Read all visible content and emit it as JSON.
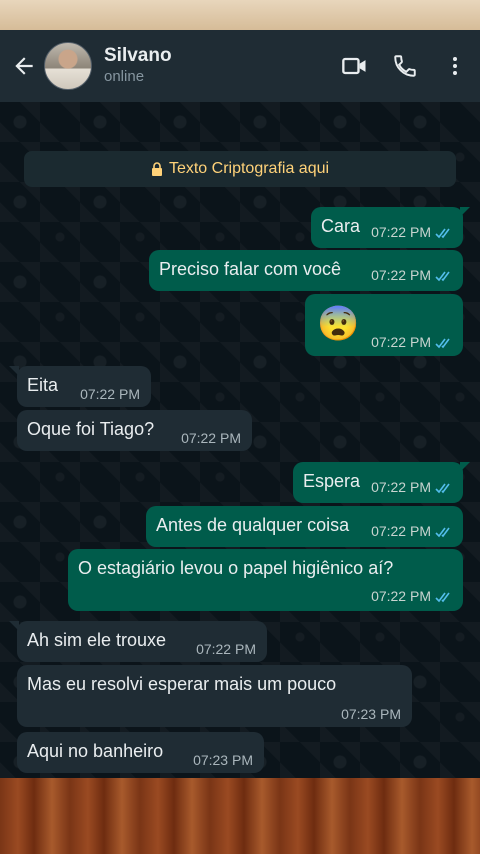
{
  "header": {
    "contact_name": "Silvano",
    "contact_status": "online",
    "back_icon": "arrow-left-icon",
    "video_icon": "video-call-icon",
    "call_icon": "phone-icon",
    "menu_icon": "more-vertical-icon"
  },
  "encryption_notice": "Texto Criptografia aqui",
  "messages": [
    {
      "dir": "out",
      "text": "Cara",
      "time": "07:22 PM",
      "read": true
    },
    {
      "dir": "out",
      "text": "Preciso falar com você",
      "time": "07:22 PM",
      "read": true
    },
    {
      "dir": "out",
      "text": "😨",
      "time": "07:22 PM",
      "read": true
    },
    {
      "dir": "in",
      "text": "Eita",
      "time": "07:22 PM"
    },
    {
      "dir": "in",
      "text": "Oque foi Tiago?",
      "time": "07:22 PM"
    },
    {
      "dir": "out",
      "text": "Espera",
      "time": "07:22 PM",
      "read": true
    },
    {
      "dir": "out",
      "text": "Antes de qualquer coisa",
      "time": "07:22 PM",
      "read": true
    },
    {
      "dir": "out",
      "text": "O estagiário levou o papel higiênico aí?",
      "time": "07:22 PM",
      "read": true
    },
    {
      "dir": "in",
      "text": "Ah sim ele trouxe",
      "time": "07:22 PM"
    },
    {
      "dir": "in",
      "text": "Mas eu resolvi esperar mais um pouco",
      "time": "07:23 PM"
    },
    {
      "dir": "in",
      "text": "Aqui no banheiro",
      "time": "07:23 PM"
    }
  ],
  "colors": {
    "outgoing_bubble": "#005c4b",
    "incoming_bubble": "#1f2c34",
    "background": "#0b141a",
    "read_ticks": "#53bdeb",
    "encryption_text": "#ffd279"
  }
}
